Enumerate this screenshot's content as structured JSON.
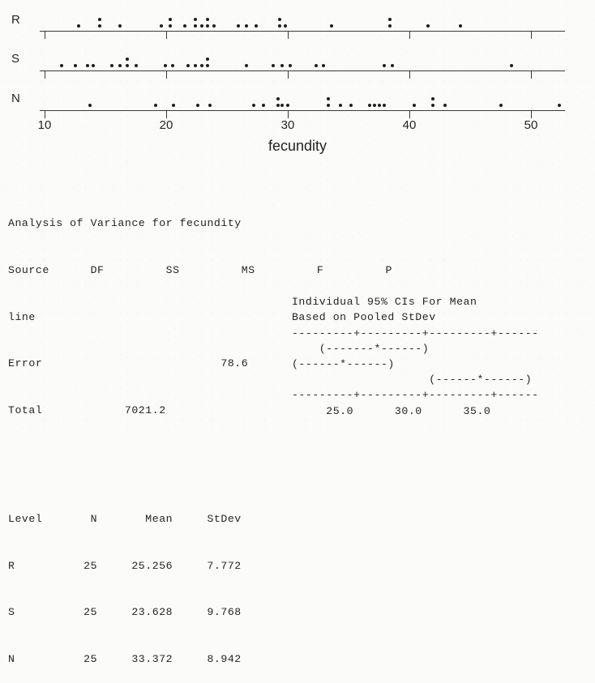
{
  "dotplot": {
    "axis": {
      "min": 9.6,
      "max": 52.8,
      "tick_values": [
        10,
        20,
        30,
        40,
        50
      ]
    },
    "tick_labels": [
      "10",
      "20",
      "30",
      "40",
      "50"
    ],
    "xlabel": "fecundity",
    "row_labels": [
      "R",
      "S",
      "N"
    ],
    "dot_color": "#201f1c",
    "axis_color": "#3a3a36"
  },
  "chart_data": {
    "type": "scatter",
    "title": "",
    "xlabel": "fecundity",
    "ylabel": "",
    "xlim": [
      9.6,
      52.8
    ],
    "grid": false,
    "legend": "none",
    "xticks": [
      10,
      20,
      30,
      40,
      50
    ],
    "xticklabels": [
      "10",
      "20",
      "30",
      "40",
      "50"
    ],
    "series": [
      {
        "name": "R",
        "values": [
          12.8,
          14.5,
          14.5,
          16.2,
          19.6,
          20.3,
          20.3,
          21.5,
          22.4,
          22.4,
          22.9,
          23.4,
          23.4,
          23.9,
          25.9,
          26.6,
          27.4,
          29.3,
          29.3,
          33.6,
          38.4,
          38.4,
          41.5,
          44.2,
          29.8
        ]
      },
      {
        "name": "S",
        "values": [
          11.4,
          12.5,
          13.5,
          14.0,
          15.5,
          16.2,
          16.8,
          16.8,
          17.5,
          19.9,
          20.5,
          21.8,
          22.4,
          22.9,
          23.4,
          23.4,
          26.6,
          28.8,
          29.5,
          30.2,
          32.3,
          32.9,
          37.9,
          38.6,
          48.4
        ]
      },
      {
        "name": "N",
        "values": [
          13.7,
          19.1,
          20.6,
          22.6,
          23.6,
          27.2,
          28.0,
          29.2,
          29.2,
          30.0,
          33.3,
          33.3,
          34.3,
          35.2,
          36.7,
          37.1,
          37.5,
          37.9,
          40.4,
          41.9,
          41.9,
          42.9,
          47.5,
          52.3,
          29.5
        ]
      }
    ]
  },
  "anova": {
    "title": "Analysis of Variance for fecundity",
    "header": {
      "source": "Source",
      "df": "DF",
      "ss": "SS",
      "ms": "MS",
      "f": "F",
      "p": "P"
    },
    "rows": [
      {
        "source": "line",
        "df": "",
        "ss": "",
        "ms": "",
        "f": "",
        "p": ""
      },
      {
        "source": "Error",
        "df": "",
        "ss": "",
        "ms": "78.6",
        "f": "",
        "p": ""
      },
      {
        "source": "Total",
        "df": "",
        "ss": "7021.2",
        "ms": "",
        "f": "",
        "p": ""
      }
    ]
  },
  "levels": {
    "header": {
      "level": "Level",
      "n": "N",
      "mean": "Mean",
      "stdev": "StDev"
    },
    "rows": [
      {
        "level": "R",
        "n": "25",
        "mean": "25.256",
        "stdev": "7.772"
      },
      {
        "level": "S",
        "n": "25",
        "mean": "23.628",
        "stdev": "9.768"
      },
      {
        "level": "N",
        "n": "25",
        "mean": "33.372",
        "stdev": "8.942"
      }
    ]
  },
  "ci_plot": {
    "caption_line1": "Individual 95% CIs For Mean",
    "caption_line2": "Based on Pooled StDev",
    "ruler_top": "---------+---------+---------+------",
    "ruler_bottom": "---------+---------+---------+------",
    "bars": [
      "    (-------*------)",
      "(------*------)",
      "                    (------*------)"
    ],
    "axis_labels": "     25.0      30.0      35.0"
  },
  "text_lines": {
    "l01": "Analysis of Variance for fecundity",
    "l02": "Source      DF         SS         MS         F         P",
    "l03": "line",
    "l04": "Error                          78.6",
    "l05": "Total            7021.2",
    "l06": "",
    "l07": "",
    "l08": "Level       N       Mean     StDev",
    "l09": "R          25     25.256     7.772",
    "l10": "S          25     23.628     9.768",
    "l11": "N          25     33.372     8.942"
  }
}
